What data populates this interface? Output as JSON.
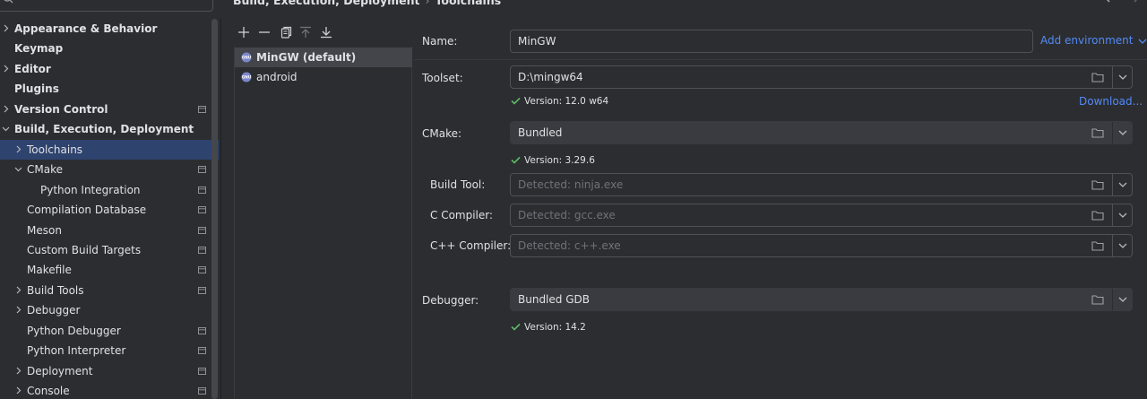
{
  "breadcrumb": {
    "parent": "Build, Execution, Deployment",
    "separator": "›",
    "current": "Toolchains"
  },
  "tree": {
    "items": [
      {
        "label": "Appearance & Behavior",
        "bold": true,
        "chevron": "right",
        "indent": 0,
        "project_icon": false
      },
      {
        "label": "Keymap",
        "bold": true,
        "chevron": null,
        "indent": 0,
        "project_icon": false
      },
      {
        "label": "Editor",
        "bold": true,
        "chevron": "right",
        "indent": 0,
        "project_icon": false
      },
      {
        "label": "Plugins",
        "bold": true,
        "chevron": null,
        "indent": 0,
        "project_icon": false
      },
      {
        "label": "Version Control",
        "bold": true,
        "chevron": "right",
        "indent": 0,
        "project_icon": true
      },
      {
        "label": "Build, Execution, Deployment",
        "bold": true,
        "chevron": "down",
        "indent": 0,
        "project_icon": false
      },
      {
        "label": "Toolchains",
        "bold": false,
        "chevron": "right",
        "indent": 1,
        "project_icon": false,
        "selected": true
      },
      {
        "label": "CMake",
        "bold": false,
        "chevron": "down",
        "indent": 1,
        "project_icon": true
      },
      {
        "label": "Python Integration",
        "bold": false,
        "chevron": null,
        "indent": 2,
        "project_icon": true
      },
      {
        "label": "Compilation Database",
        "bold": false,
        "chevron": null,
        "indent": 1,
        "project_icon": true
      },
      {
        "label": "Meson",
        "bold": false,
        "chevron": null,
        "indent": 1,
        "project_icon": true
      },
      {
        "label": "Custom Build Targets",
        "bold": false,
        "chevron": null,
        "indent": 1,
        "project_icon": true
      },
      {
        "label": "Makefile",
        "bold": false,
        "chevron": null,
        "indent": 1,
        "project_icon": true
      },
      {
        "label": "Build Tools",
        "bold": false,
        "chevron": "right",
        "indent": 1,
        "project_icon": true
      },
      {
        "label": "Debugger",
        "bold": false,
        "chevron": "right",
        "indent": 1,
        "project_icon": false
      },
      {
        "label": "Python Debugger",
        "bold": false,
        "chevron": null,
        "indent": 1,
        "project_icon": true
      },
      {
        "label": "Python Interpreter",
        "bold": false,
        "chevron": null,
        "indent": 1,
        "project_icon": true
      },
      {
        "label": "Deployment",
        "bold": false,
        "chevron": "right",
        "indent": 1,
        "project_icon": true
      },
      {
        "label": "Console",
        "bold": false,
        "chevron": "right",
        "indent": 1,
        "project_icon": true
      }
    ]
  },
  "toolbar": {
    "add": "add-icon",
    "remove": "remove-icon",
    "copy": "copy-icon",
    "move_up": "move-up-icon",
    "move_down": "move-down-icon"
  },
  "toolchains": [
    {
      "label": "MinGW (default)",
      "selected": true
    },
    {
      "label": "android",
      "selected": false
    }
  ],
  "details": {
    "name_label": "Name:",
    "name_value": "MinGW",
    "add_environment": "Add environment",
    "toolset_label": "Toolset:",
    "toolset_value": "D:\\mingw64",
    "toolset_version": "Version: 12.0 w64",
    "download_link": "Download...",
    "cmake_label": "CMake:",
    "cmake_value": "Bundled",
    "cmake_version": "Version: 3.29.6",
    "build_tool_label": "Build Tool:",
    "build_tool_placeholder": "Detected: ninja.exe",
    "c_compiler_label": "C Compiler:",
    "c_compiler_placeholder": "Detected: gcc.exe",
    "cpp_compiler_label": "C++ Compiler:",
    "cpp_compiler_placeholder": "Detected: c++.exe",
    "debugger_label": "Debugger:",
    "debugger_value": "Bundled GDB",
    "debugger_version": "Version: 14.2"
  },
  "colors": {
    "background": "#2b2d30",
    "selection": "#2e436e",
    "list_selection": "#43454a",
    "link": "#548af7",
    "success": "#5fb865"
  }
}
